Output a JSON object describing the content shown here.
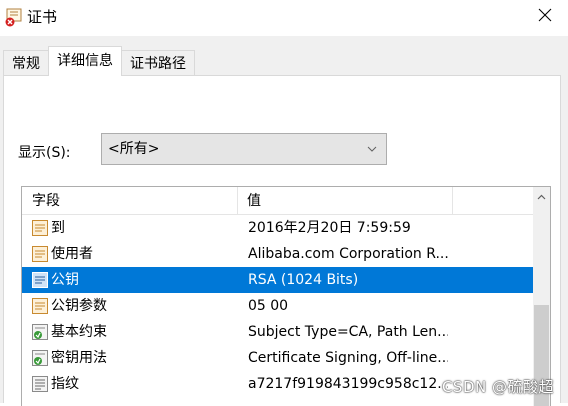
{
  "window": {
    "title": "证书"
  },
  "tabs": [
    {
      "label": "常规",
      "active": false
    },
    {
      "label": "详细信息",
      "active": true
    },
    {
      "label": "证书路径",
      "active": false
    }
  ],
  "show": {
    "label": "显示(S):",
    "selected": "<所有>"
  },
  "list": {
    "headers": {
      "field": "字段",
      "value": "值"
    },
    "rows": [
      {
        "field": "到",
        "value": "2016年2月20日 7:59:59",
        "icon": "cert-field-icon",
        "selected": false
      },
      {
        "field": "使用者",
        "value": "Alibaba.com Corporation R...",
        "icon": "cert-field-icon",
        "selected": false
      },
      {
        "field": "公钥",
        "value": "RSA (1024 Bits)",
        "icon": "cert-field-icon",
        "selected": true
      },
      {
        "field": "公钥参数",
        "value": "05 00",
        "icon": "cert-field-icon",
        "selected": false
      },
      {
        "field": "基本约束",
        "value": "Subject Type=CA, Path Len...",
        "icon": "cert-extension-icon",
        "selected": false
      },
      {
        "field": "密钥用法",
        "value": "Certificate Signing, Off-line...",
        "icon": "cert-extension-icon",
        "selected": false
      },
      {
        "field": "指纹",
        "value": "a7217f919843199c958c12...",
        "icon": "cert-property-icon",
        "selected": false
      }
    ]
  },
  "watermark": "CSDN @硫酸超",
  "colors": {
    "selection": "#0078d7",
    "dialog_bg": "#f0f0f0",
    "combo_bg": "#e5e5e5",
    "icon_orange": "#e8a040",
    "icon_green": "#3a9a3a"
  }
}
